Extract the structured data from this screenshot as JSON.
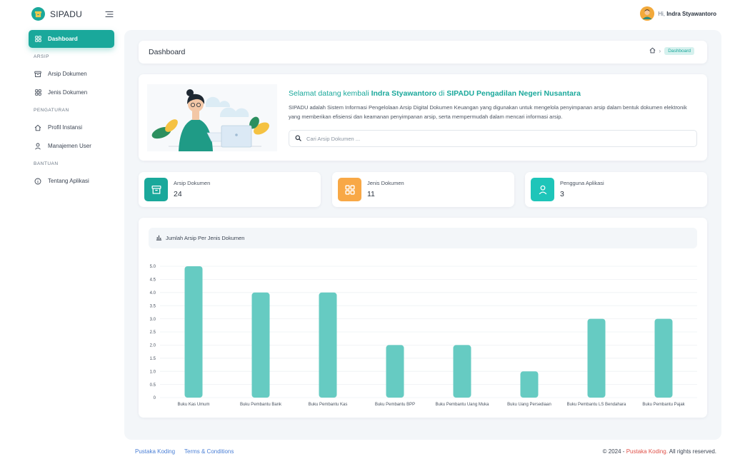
{
  "app": {
    "name": "SIPADU",
    "accent": "#1aa89b",
    "logo_icon": "archive-logo-icon",
    "menu_icon": "hamburger-icon"
  },
  "user": {
    "greeting": "Hi,",
    "name": "Indra Styawantoro"
  },
  "sidebar": {
    "items": [
      {
        "label": "Dashboard",
        "icon": "grid-icon",
        "active": true
      },
      {
        "heading": "ARSIP"
      },
      {
        "label": "Arsip Dokumen",
        "icon": "archive-icon"
      },
      {
        "label": "Jenis Dokumen",
        "icon": "grid-icon"
      },
      {
        "heading": "PENGATURAN"
      },
      {
        "label": "Profil Instansi",
        "icon": "home-icon"
      },
      {
        "label": "Manajemen User",
        "icon": "user-icon"
      },
      {
        "heading": "BANTUAN"
      },
      {
        "label": "Tentang Aplikasi",
        "icon": "info-icon"
      }
    ]
  },
  "header": {
    "title": "Dashboard",
    "breadcrumb_home_icon": "home-icon",
    "breadcrumb_current": "Dashboard"
  },
  "welcome": {
    "prefix": "Selamat datang kembali",
    "user": "Indra Styawantoro",
    "middle": "di",
    "org": "SIPADU Pengadilan Negeri Nusantara",
    "description": "SIPADU adalah Sistem Informasi Pengelolaan Arsip Digital Dokumen Keuangan yang digunakan untuk mengelola penyimpanan arsip dalam bentuk dokumen elektronik yang memberikan efisiensi dan keamanan penyimpanan arsip, serta mempermudah dalam mencari informasi arsip.",
    "search_placeholder": "Cari Arsip Dokumen ..."
  },
  "stats": [
    {
      "label": "Arsip Dokumen",
      "value": "24",
      "icon": "archive-icon",
      "color": "#1aa89b"
    },
    {
      "label": "Jenis Dokumen",
      "value": "11",
      "icon": "grid-icon",
      "color": "#f8a846"
    },
    {
      "label": "Pengguna Aplikasi",
      "value": "3",
      "icon": "user-icon",
      "color": "#1ec5b9"
    }
  ],
  "chart_title": "Jumlah Arsip Per Jenis Dokumen",
  "chart_data": {
    "type": "bar",
    "categories": [
      "Buku Kas Umum",
      "Buku Pembantu Bank",
      "Buku Pembantu Kas",
      "Buku Pembantu BPP",
      "Buku Pembantu Uang Muka",
      "Buku Uang Persediaan",
      "Buku Pembantu LS Bendahara",
      "Buku Pembantu Pajak"
    ],
    "values": [
      5,
      4,
      4,
      2,
      2,
      1,
      3,
      3
    ],
    "ylim": [
      0,
      5
    ],
    "yticks": [
      "0",
      "0.5",
      "1.0",
      "1.5",
      "2.0",
      "2.5",
      "3.0",
      "3.5",
      "4.0",
      "4.5",
      "5.0"
    ],
    "bar_color": "#66cbc2",
    "grid": true
  },
  "footer": {
    "link1": "Pustaka Koding",
    "link2": "Terms & Conditions",
    "copy_prefix": "© 2024 -",
    "copy_brand": "Pustaka Koding.",
    "copy_suffix": "All rights reserved."
  }
}
